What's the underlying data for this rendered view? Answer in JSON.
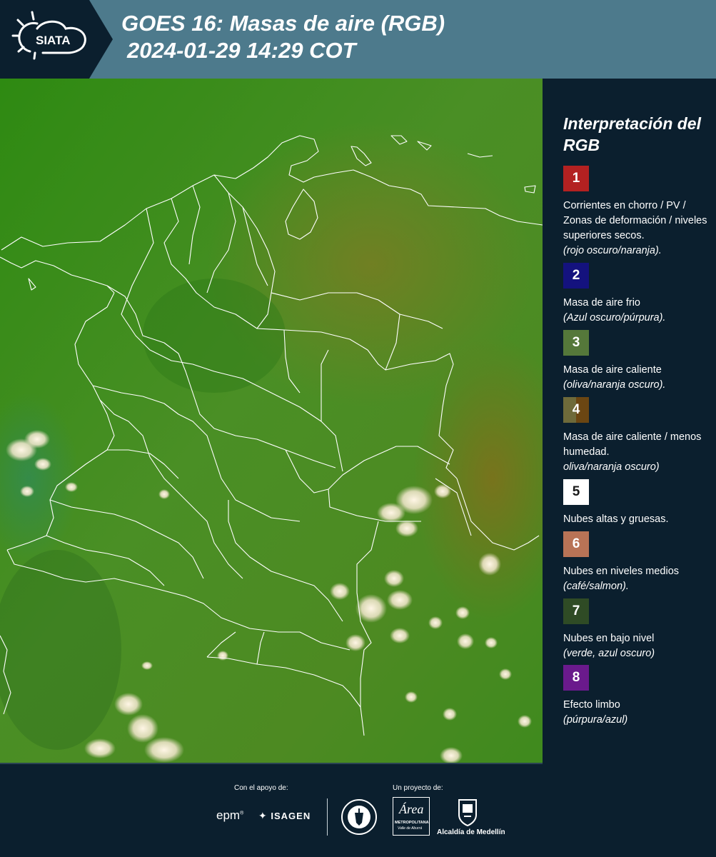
{
  "header": {
    "logo_text": "SIATA",
    "title_line1": "GOES 16: Masas de aire (RGB)",
    "title_line2": "2024-01-29 14:29 COT"
  },
  "legend": {
    "title": "Interpretación del RGB",
    "items": [
      {
        "num": "1",
        "color": "#b32121",
        "text": "Corrientes en chorro / PV / Zonas de deformación / niveles superiores secos.",
        "note": "(rojo oscuro/naranja)."
      },
      {
        "num": "2",
        "color": "#14127e",
        "text": "Masa de aire frio",
        "note": "(Azul oscuro/púrpura)."
      },
      {
        "num": "3",
        "color": "#55783a",
        "text": "Masa de aire caliente",
        "note": "(oliva/naranja oscuro)."
      },
      {
        "num": "4",
        "color": "#6b4612",
        "text": "Masa de aire caliente / menos humedad.",
        "note": "oliva/naranja oscuro)"
      },
      {
        "num": "5",
        "color": "#ffffff",
        "text": "Nubes altas y gruesas.",
        "note": ""
      },
      {
        "num": "6",
        "color": "#b87356",
        "text": "Nubes en niveles medios",
        "note": "(café/salmon)."
      },
      {
        "num": "7",
        "color": "#2f4b25",
        "text": "Nubes en bajo nivel",
        "note": "(verde, azul oscuro)"
      },
      {
        "num": "8",
        "color": "#6a1a8c",
        "text": "Efecto limbo",
        "note": "(púrpura/azul)"
      }
    ]
  },
  "footer": {
    "support_label": "Con el apoyo de:",
    "project_label": "Un proyecto de:",
    "epm": "epm",
    "isagen": "ISAGEN",
    "area_metro": "Área",
    "area_metro_sub": "METROPOLITANA",
    "area_metro_sub2": "Valle de Aburrá",
    "alcaldia": "Alcaldía de Medellín"
  }
}
